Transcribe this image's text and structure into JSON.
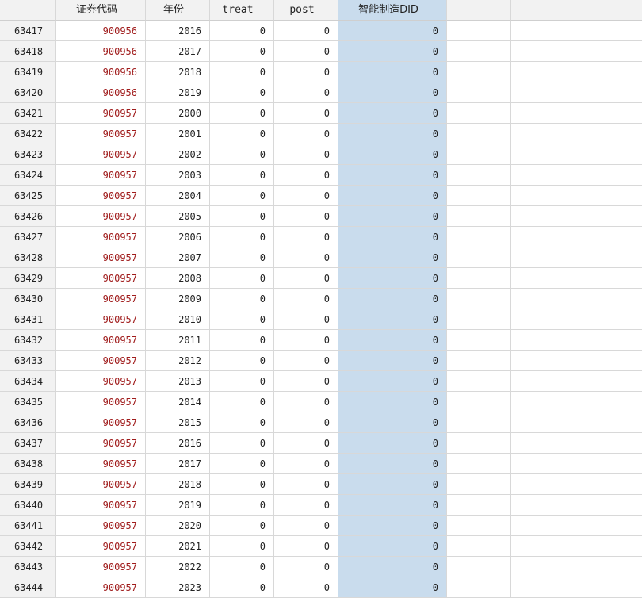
{
  "columns": [
    "",
    "证券代码",
    "年份",
    "treat",
    "post",
    "智能制造DID",
    "",
    "",
    ""
  ],
  "rows": [
    {
      "id": "63417",
      "code": "900956",
      "year": "2016",
      "treat": "0",
      "post": "0",
      "did": "0"
    },
    {
      "id": "63418",
      "code": "900956",
      "year": "2017",
      "treat": "0",
      "post": "0",
      "did": "0"
    },
    {
      "id": "63419",
      "code": "900956",
      "year": "2018",
      "treat": "0",
      "post": "0",
      "did": "0"
    },
    {
      "id": "63420",
      "code": "900956",
      "year": "2019",
      "treat": "0",
      "post": "0",
      "did": "0"
    },
    {
      "id": "63421",
      "code": "900957",
      "year": "2000",
      "treat": "0",
      "post": "0",
      "did": "0"
    },
    {
      "id": "63422",
      "code": "900957",
      "year": "2001",
      "treat": "0",
      "post": "0",
      "did": "0"
    },
    {
      "id": "63423",
      "code": "900957",
      "year": "2002",
      "treat": "0",
      "post": "0",
      "did": "0"
    },
    {
      "id": "63424",
      "code": "900957",
      "year": "2003",
      "treat": "0",
      "post": "0",
      "did": "0"
    },
    {
      "id": "63425",
      "code": "900957",
      "year": "2004",
      "treat": "0",
      "post": "0",
      "did": "0"
    },
    {
      "id": "63426",
      "code": "900957",
      "year": "2005",
      "treat": "0",
      "post": "0",
      "did": "0"
    },
    {
      "id": "63427",
      "code": "900957",
      "year": "2006",
      "treat": "0",
      "post": "0",
      "did": "0"
    },
    {
      "id": "63428",
      "code": "900957",
      "year": "2007",
      "treat": "0",
      "post": "0",
      "did": "0"
    },
    {
      "id": "63429",
      "code": "900957",
      "year": "2008",
      "treat": "0",
      "post": "0",
      "did": "0"
    },
    {
      "id": "63430",
      "code": "900957",
      "year": "2009",
      "treat": "0",
      "post": "0",
      "did": "0"
    },
    {
      "id": "63431",
      "code": "900957",
      "year": "2010",
      "treat": "0",
      "post": "0",
      "did": "0"
    },
    {
      "id": "63432",
      "code": "900957",
      "year": "2011",
      "treat": "0",
      "post": "0",
      "did": "0"
    },
    {
      "id": "63433",
      "code": "900957",
      "year": "2012",
      "treat": "0",
      "post": "0",
      "did": "0"
    },
    {
      "id": "63434",
      "code": "900957",
      "year": "2013",
      "treat": "0",
      "post": "0",
      "did": "0"
    },
    {
      "id": "63435",
      "code": "900957",
      "year": "2014",
      "treat": "0",
      "post": "0",
      "did": "0"
    },
    {
      "id": "63436",
      "code": "900957",
      "year": "2015",
      "treat": "0",
      "post": "0",
      "did": "0"
    },
    {
      "id": "63437",
      "code": "900957",
      "year": "2016",
      "treat": "0",
      "post": "0",
      "did": "0"
    },
    {
      "id": "63438",
      "code": "900957",
      "year": "2017",
      "treat": "0",
      "post": "0",
      "did": "0"
    },
    {
      "id": "63439",
      "code": "900957",
      "year": "2018",
      "treat": "0",
      "post": "0",
      "did": "0"
    },
    {
      "id": "63440",
      "code": "900957",
      "year": "2019",
      "treat": "0",
      "post": "0",
      "did": "0"
    },
    {
      "id": "63441",
      "code": "900957",
      "year": "2020",
      "treat": "0",
      "post": "0",
      "did": "0"
    },
    {
      "id": "63442",
      "code": "900957",
      "year": "2021",
      "treat": "0",
      "post": "0",
      "did": "0"
    },
    {
      "id": "63443",
      "code": "900957",
      "year": "2022",
      "treat": "0",
      "post": "0",
      "did": "0"
    },
    {
      "id": "63444",
      "code": "900957",
      "year": "2023",
      "treat": "0",
      "post": "0",
      "did": "0"
    }
  ],
  "colors": {
    "code_text": "#a01c1c",
    "selected_column": "#c9dced",
    "header_bg": "#f2f2f2",
    "grid_line": "#d8d8d8"
  }
}
